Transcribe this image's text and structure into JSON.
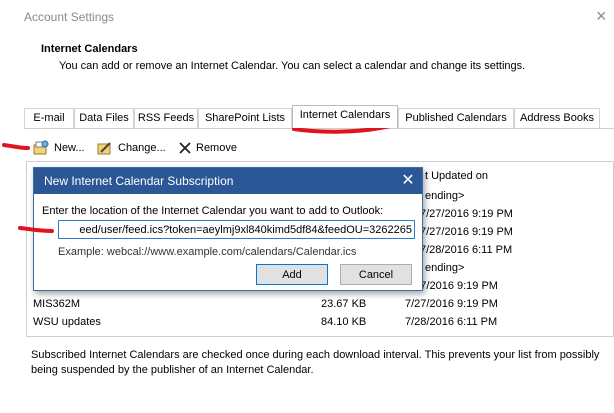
{
  "window": {
    "title": "Account Settings"
  },
  "section": {
    "heading": "Internet Calendars",
    "description": "You can add or remove an Internet Calendar. You can select a calendar and change its settings."
  },
  "tabs": [
    {
      "label": "E-mail"
    },
    {
      "label": "Data Files"
    },
    {
      "label": "RSS Feeds"
    },
    {
      "label": "SharePoint Lists"
    },
    {
      "label": "Internet Calendars",
      "active": true
    },
    {
      "label": "Published Calendars"
    },
    {
      "label": "Address Books"
    }
  ],
  "toolbar": {
    "new_label": "New...",
    "change_label": "Change...",
    "remove_label": "Remove"
  },
  "list": {
    "col_last_updated": "t Updated on",
    "rows": [
      {
        "name": "",
        "size": "",
        "updated": "ending>"
      },
      {
        "name": "",
        "size": "",
        "updated": "7/27/2016 9:19 PM"
      },
      {
        "name": "",
        "size": "",
        "updated": "7/27/2016 9:19 PM"
      },
      {
        "name": "",
        "size": "",
        "updated": "7/28/2016 6:11 PM"
      },
      {
        "name": "",
        "size": "",
        "updated": "ending>"
      },
      {
        "name": "",
        "size": "",
        "updated": "7/27/2016 9:19 PM"
      },
      {
        "name": "MIS362M",
        "size": "23.67 KB",
        "updated": "7/27/2016 9:19 PM"
      },
      {
        "name": "WSU updates",
        "size": "84.10 KB",
        "updated": "7/28/2016 6:11 PM"
      }
    ]
  },
  "footnote": "Subscribed Internet Calendars are checked once during each download interval. This prevents your list from possibly being suspended by the publisher of an Internet Calendar.",
  "dialog": {
    "title": "New Internet Calendar Subscription",
    "prompt": "Enter the location of the Internet Calendar you want to add to Outlook:",
    "url_value": "eed/user/feed.ics?token=aeylmj9xl840kimd5df84&feedOU=3262265",
    "example": "Example: webcal://www.example.com/calendars/Calendar.ics",
    "add_label": "Add",
    "cancel_label": "Cancel"
  },
  "colors": {
    "dialog_title_bg": "#2b5797",
    "annotation_red": "#e0141e",
    "input_border": "#2b7bd6"
  }
}
